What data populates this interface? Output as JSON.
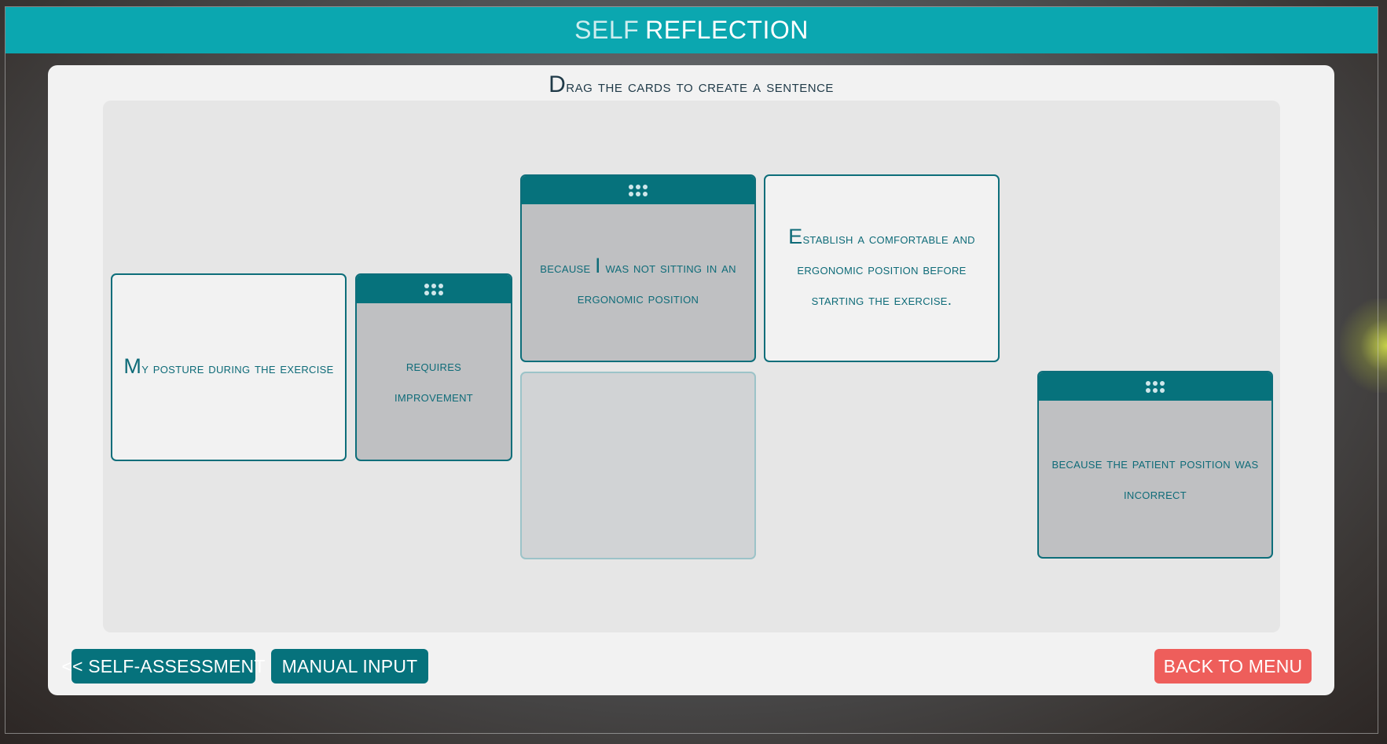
{
  "window": {
    "title_light": "SELF",
    "title_bold": "REFLECTION"
  },
  "instruction": {
    "first": "D",
    "rest": "rag the cards to create a sentence"
  },
  "cards": {
    "c1": {
      "cap": "M",
      "rest": "y posture during the exercise"
    },
    "c2": {
      "text": "requires improvement"
    },
    "c3": {
      "pre": "because ",
      "cap": "I",
      "rest": " was not sitting in an ergonomic position"
    },
    "c4": {
      "cap": "E",
      "rest": "stablish a comfortable and ergonomic position before starting the exercise."
    },
    "c5": {
      "text": "because the patient position was incorrect"
    }
  },
  "buttons": {
    "self_assessment": "<< SELF-ASSESSMENT",
    "manual_input": "MANUAL INPUT",
    "back_to_menu": "BACK TO MENU"
  },
  "colors": {
    "header": "#0ba7b0",
    "card_border": "#0d6e7a",
    "handle": "#06727c",
    "back_button": "#ee5e5b"
  },
  "icons": {
    "card_handle": "drag-grip-icon"
  }
}
